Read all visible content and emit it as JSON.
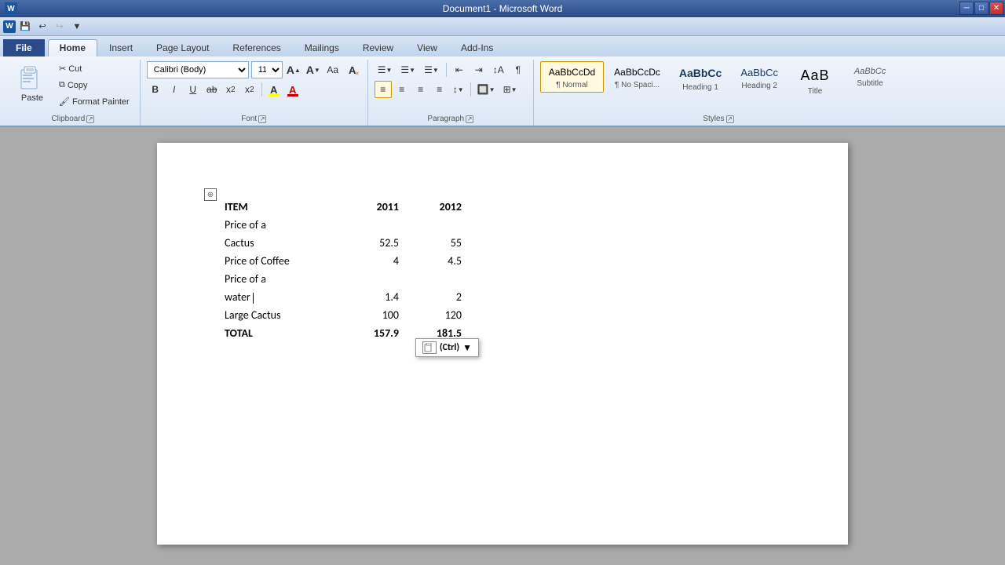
{
  "titlebar": {
    "title": "Document1 - Microsoft Word",
    "win_minimize": "─",
    "win_restore": "□",
    "win_close": "✕"
  },
  "quickaccess": {
    "save_label": "💾",
    "undo_label": "↩",
    "redo_label": "↪",
    "customize_label": "▼"
  },
  "ribbon": {
    "tabs": [
      "File",
      "Home",
      "Insert",
      "Page Layout",
      "References",
      "Mailings",
      "Review",
      "View",
      "Add-Ins"
    ],
    "active_tab": "Home",
    "groups": {
      "clipboard": {
        "label": "Clipboard",
        "paste_label": "Paste",
        "cut_label": "Cut",
        "copy_label": "Copy",
        "format_painter_label": "Format Painter"
      },
      "font": {
        "label": "Font",
        "font_name": "Calibri (Body)",
        "font_size": "11",
        "bold": "B",
        "italic": "I",
        "underline": "U",
        "strikethrough": "ab",
        "subscript": "x₂",
        "superscript": "x²",
        "grow": "A",
        "shrink": "A",
        "change_case": "Aa",
        "clear_format": "A",
        "highlight_label": "A",
        "color_label": "A"
      },
      "paragraph": {
        "label": "Paragraph"
      },
      "styles": {
        "label": "Styles",
        "items": [
          {
            "label": "Normal",
            "preview": "AaBbCcDd",
            "active": true
          },
          {
            "label": "No Spaci...",
            "preview": "AaBbCcDc",
            "active": false
          },
          {
            "label": "Heading 1",
            "preview": "AaBbCc",
            "active": false
          },
          {
            "label": "Heading 2",
            "preview": "AaBbCc",
            "active": false
          },
          {
            "label": "Title",
            "preview": "AaB",
            "active": false
          },
          {
            "label": "Subtitle",
            "preview": "AaBbCc",
            "active": false
          }
        ]
      }
    }
  },
  "document": {
    "table": {
      "headers": [
        "ITEM",
        "2011",
        "2012"
      ],
      "rows": [
        {
          "item": "Price of a",
          "col2": "",
          "col3": ""
        },
        {
          "item": "Cactus",
          "col2": "52.5",
          "col3": "55"
        },
        {
          "item": "Price of Coffee",
          "col2": "4",
          "col3": "4.5"
        },
        {
          "item": "Price of a",
          "col2": "",
          "col3": ""
        },
        {
          "item": "water",
          "col2": "1.4",
          "col3": "2"
        },
        {
          "item": "Large Cactus",
          "col2": "100",
          "col3": "120"
        },
        {
          "item": "TOTAL",
          "col2": "157.9",
          "col3": "181.5"
        }
      ]
    },
    "ctrl_popup_label": "(Ctrl)"
  }
}
